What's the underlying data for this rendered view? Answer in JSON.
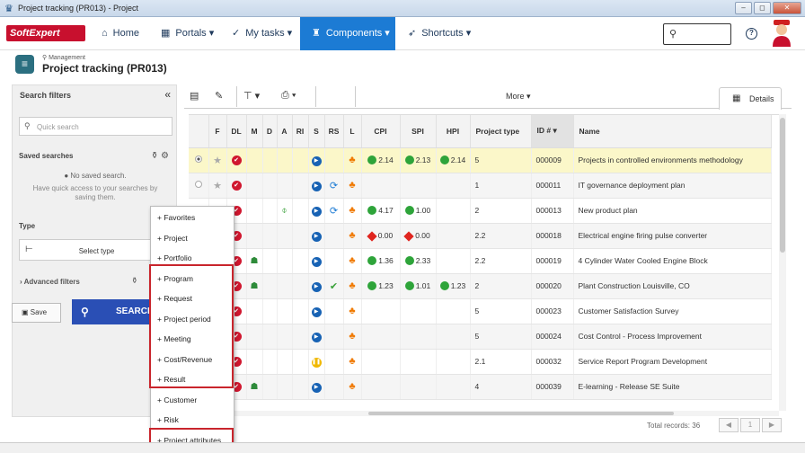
{
  "window": {
    "title": "Project tracking (PR013) - Project",
    "buttons": [
      "–",
      "◻",
      "✕"
    ]
  },
  "nav": {
    "logo": "SoftExpert",
    "items": [
      {
        "label": "Home",
        "icon": "home-icon",
        "glyph": "⌂"
      },
      {
        "label": "Portals ▾",
        "icon": "portals-icon",
        "glyph": "▦"
      },
      {
        "label": "My tasks ▾",
        "icon": "check-icon",
        "glyph": "✓"
      },
      {
        "label": "Components ▾",
        "icon": "trophy-icon",
        "glyph": "♜"
      },
      {
        "label": "Shortcuts ▾",
        "icon": "rocket-icon",
        "glyph": "➶"
      }
    ],
    "help": "?"
  },
  "page": {
    "breadcrumb": "Management",
    "title": "Project tracking (PR013)"
  },
  "filters": {
    "header": "Search filters",
    "collapse": "«",
    "quick_search_placeholder": "Quick search",
    "saved_label": "Saved searches",
    "no_saved": "No saved search.",
    "no_saved_hint": "Have quick access to your searches by saving them.",
    "type_label": "Type",
    "select_type": "Select type",
    "advanced": "Advanced filters",
    "save": "Save",
    "search": "SEARCH"
  },
  "toolbar": {
    "more": "More ▾",
    "details_tab": "Details"
  },
  "grid": {
    "columns": [
      "",
      "F",
      "DL",
      "M",
      "D",
      "A",
      "RI",
      "S",
      "RS",
      "L",
      "CPI",
      "SPI",
      "HPI",
      "Project type",
      "ID # ▾",
      "Name"
    ],
    "rows": [
      {
        "cpi": "2.14",
        "spi": "2.13",
        "hpi": "2.14",
        "type": "5",
        "id": "000009",
        "name": "Projects in controlled environments methodology",
        "m": false,
        "a": false,
        "rs": "",
        "s": "play",
        "cpi_s": "g",
        "spi_s": "g"
      },
      {
        "cpi": "",
        "spi": "",
        "hpi": "",
        "type": "1",
        "id": "000011",
        "name": "IT governance deployment plan",
        "m": false,
        "a": false,
        "rs": "sync",
        "s": "play",
        "cpi_s": "",
        "spi_s": ""
      },
      {
        "cpi": "4.17",
        "spi": "1.00",
        "hpi": "",
        "type": "2",
        "id": "000013",
        "name": "New product plan",
        "m": false,
        "a": true,
        "rs": "sync",
        "s": "play",
        "cpi_s": "g",
        "spi_s": "g"
      },
      {
        "cpi": "0.00",
        "spi": "0.00",
        "hpi": "",
        "type": "2.2",
        "id": "000018",
        "name": "Electrical engine firing pulse converter",
        "m": false,
        "a": false,
        "rs": "",
        "s": "play",
        "cpi_s": "r",
        "spi_s": "r"
      },
      {
        "cpi": "1.36",
        "spi": "2.33",
        "hpi": "",
        "type": "2.2",
        "id": "000019",
        "name": "4 Cylinder Water Cooled Engine Block",
        "m": true,
        "a": false,
        "rs": "",
        "s": "play",
        "cpi_s": "g",
        "spi_s": "g"
      },
      {
        "cpi": "1.23",
        "spi": "1.01",
        "hpi": "1.23",
        "type": "2",
        "id": "000020",
        "name": "Plant Construction Louisville, CO",
        "m": true,
        "a": false,
        "rs": "check",
        "s": "play",
        "cpi_s": "g",
        "spi_s": "g"
      },
      {
        "cpi": "",
        "spi": "",
        "hpi": "",
        "type": "5",
        "id": "000023",
        "name": "Customer Satisfaction Survey",
        "m": false,
        "a": false,
        "rs": "",
        "s": "play",
        "cpi_s": "",
        "spi_s": ""
      },
      {
        "cpi": "",
        "spi": "",
        "hpi": "",
        "type": "5",
        "id": "000024",
        "name": "Cost Control - Process Improvement",
        "m": false,
        "a": false,
        "rs": "",
        "s": "play",
        "cpi_s": "",
        "spi_s": ""
      },
      {
        "cpi": "",
        "spi": "",
        "hpi": "",
        "type": "2.1",
        "id": "000032",
        "name": "Service Report Program Development",
        "m": false,
        "a": false,
        "rs": "",
        "s": "pause",
        "cpi_s": "",
        "spi_s": ""
      },
      {
        "cpi": "",
        "spi": "",
        "hpi": "",
        "type": "4",
        "id": "000039",
        "name": "E-learning - Release SE Suite",
        "m": true,
        "a": false,
        "rs": "",
        "s": "play",
        "cpi_s": "",
        "spi_s": ""
      }
    ],
    "total": "Total records: 36",
    "page": "1"
  },
  "menu": {
    "items": [
      "Favorites",
      "Project",
      "Portfolio",
      "Program",
      "Request",
      "Project period",
      "Meeting",
      "Cost/Revenue",
      "Result",
      "Customer",
      "Risk",
      "Project attributes"
    ]
  },
  "colors": {
    "accent": "#1c7bd4",
    "highlight": "#c9252c",
    "search": "#2a4fb5"
  }
}
